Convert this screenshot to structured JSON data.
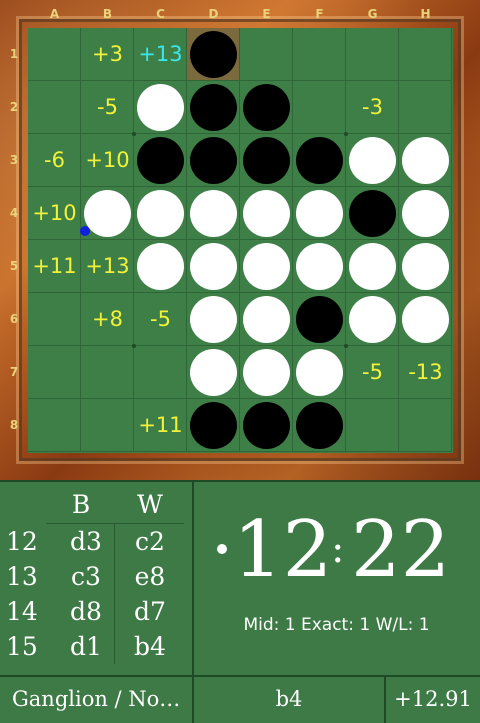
{
  "board": {
    "columns": [
      "A",
      "B",
      "C",
      "D",
      "E",
      "F",
      "G",
      "H"
    ],
    "rows": [
      "1",
      "2",
      "3",
      "4",
      "5",
      "6",
      "7",
      "8"
    ],
    "discs": [
      [
        "",
        "",
        "",
        "black",
        "",
        "",
        "",
        ""
      ],
      [
        "",
        "",
        "white",
        "black",
        "black",
        "",
        "",
        ""
      ],
      [
        "",
        "",
        "black",
        "black",
        "black",
        "black",
        "white",
        "white"
      ],
      [
        "",
        "white",
        "white",
        "white",
        "white",
        "white",
        "black",
        "white"
      ],
      [
        "",
        "",
        "white",
        "white",
        "white",
        "white",
        "white",
        "white"
      ],
      [
        "",
        "",
        "",
        "white",
        "white",
        "black",
        "white",
        "white"
      ],
      [
        "",
        "",
        "",
        "white",
        "white",
        "white",
        "",
        ""
      ],
      [
        "",
        "",
        "",
        "black",
        "black",
        "black",
        "",
        ""
      ]
    ],
    "scores": [
      [
        "",
        "+3",
        "+13",
        "",
        "",
        "",
        "",
        ""
      ],
      [
        "",
        "-5",
        "",
        "",
        "",
        "",
        "-3",
        ""
      ],
      [
        "-6",
        "+10",
        "",
        "",
        "",
        "",
        "",
        ""
      ],
      [
        "+10",
        "",
        "",
        "",
        "",
        "",
        "",
        ""
      ],
      [
        "+11",
        "+13",
        "",
        "",
        "",
        "",
        "",
        ""
      ],
      [
        "",
        "+8",
        "-5",
        "",
        "",
        "",
        "",
        ""
      ],
      [
        "",
        "",
        "",
        "",
        "",
        "",
        "-5",
        "-13"
      ],
      [
        "",
        "",
        "+11",
        "",
        "",
        "",
        "",
        ""
      ]
    ],
    "best_score_cell": "C1",
    "last_move_cell": "D1",
    "last_move_marker_cell": "B4",
    "colors": {
      "board": "#3e7f47",
      "score": "#f2f23a",
      "best_score": "#38e8ee",
      "last_move_marker": "#1020e0"
    }
  },
  "moves": {
    "header_black": "B",
    "header_white": "W",
    "rows": [
      {
        "num": "12",
        "black": "d3",
        "white": "c2"
      },
      {
        "num": "13",
        "black": "c3",
        "white": "e8"
      },
      {
        "num": "14",
        "black": "d8",
        "white": "d7"
      },
      {
        "num": "15",
        "black": "d1",
        "white": "b4"
      }
    ]
  },
  "clock": {
    "minutes": "12",
    "seconds": "22",
    "separator": ":"
  },
  "depth": "Mid: 1 Exact: 1 W/L: 1",
  "status": {
    "engine": "Ganglion / No…",
    "last_move": "b4",
    "evaluation": "+12.91"
  }
}
